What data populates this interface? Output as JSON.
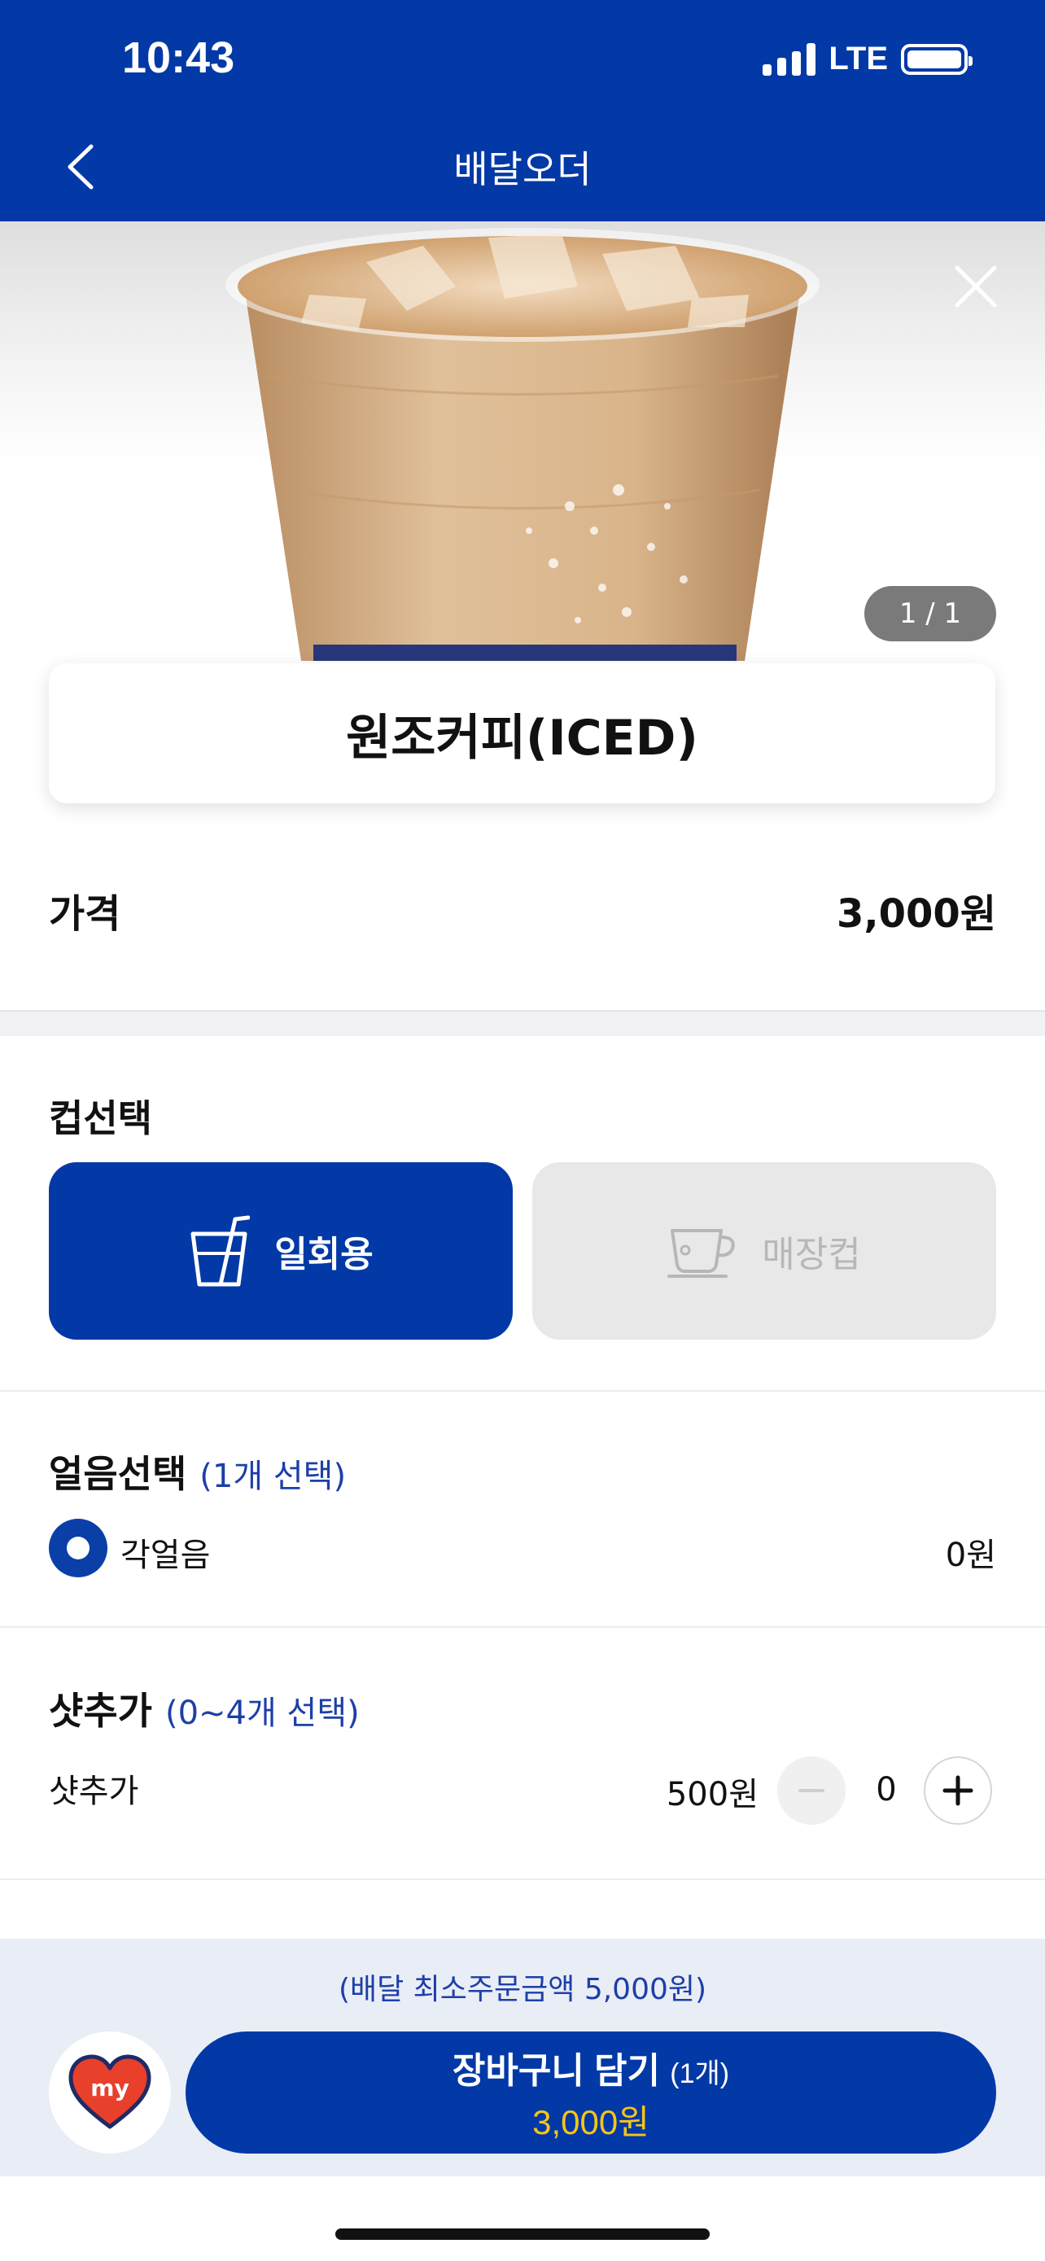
{
  "status_bar": {
    "time": "10:43",
    "network": "LTE"
  },
  "nav": {
    "title": "배달오더",
    "back_icon": "chevron-left-icon"
  },
  "hero": {
    "page_indicator": "1 / 1",
    "close_icon": "close-icon"
  },
  "product": {
    "name": "원조커피(ICED)"
  },
  "price": {
    "label": "가격",
    "value": "3,000원"
  },
  "cup_select": {
    "title": "컵선택",
    "options": [
      {
        "label": "일회용",
        "icon": "disposable-cup-icon",
        "selected": true
      },
      {
        "label": "매장컵",
        "icon": "mug-icon",
        "selected": false
      }
    ]
  },
  "ice_select": {
    "title": "얼음선택",
    "subtitle": "(1개 선택)",
    "options": [
      {
        "label": "각얼음",
        "price": "0원",
        "selected": true
      }
    ]
  },
  "shot_add": {
    "title": "샷추가",
    "subtitle": "(0~4개 선택)",
    "item": {
      "label": "샷추가",
      "price": "500원",
      "count": "0"
    }
  },
  "footer": {
    "min_order": "(배달 최소주문금액 5,000원)",
    "my_badge": "my",
    "cart_label": "장바구니 담기",
    "cart_count": "(1개)",
    "cart_price": "3,000원"
  },
  "colors": {
    "primary": "#0239a6",
    "accent_price": "#f5c518",
    "subtitle": "#1d3fa8"
  }
}
